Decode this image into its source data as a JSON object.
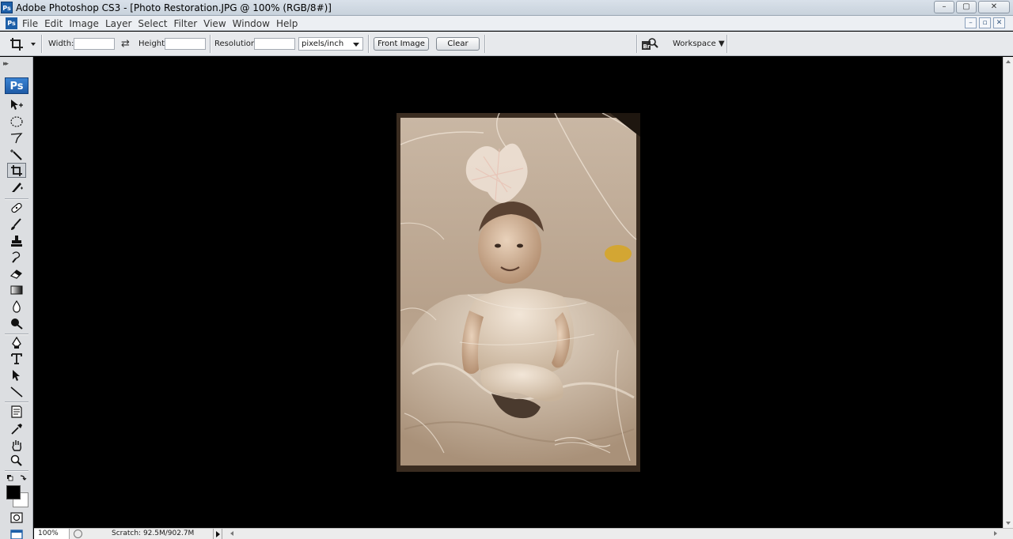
{
  "window": {
    "title": "Adobe Photoshop CS3 - [Photo Restoration.JPG @ 100% (RGB/8#)]",
    "app_icon_text": "Ps",
    "minimize": "–",
    "maximize": "▢",
    "close": "✕"
  },
  "menubar": {
    "items": [
      "File",
      "Edit",
      "Image",
      "Layer",
      "Select",
      "Filter",
      "View",
      "Window",
      "Help"
    ],
    "doc_minimize": "–",
    "doc_restore": "▫",
    "doc_close": "✕"
  },
  "options": {
    "width_label": "Width:",
    "width_value": "",
    "height_label": "Height:",
    "height_value": "",
    "resolution_label": "Resolution:",
    "resolution_value": "",
    "units_value": "pixels/inch",
    "front_image_label": "Front Image",
    "clear_label": "Clear",
    "workspace_label": "Workspace ▼",
    "bridge_icon_text": "Br",
    "swap_glyph": "⇄"
  },
  "toolbox": {
    "logo_text": "Ps",
    "grip_text": "▸▸",
    "active_tool": "crop-tool",
    "foreground_color": "#000000",
    "background_color": "#ffffff"
  },
  "document": {
    "name": "Photo Restoration.JPG",
    "zoom": "100%",
    "color_mode": "RGB/8#"
  },
  "statusbar": {
    "zoom": "100%",
    "scratch": "Scratch: 92.5M/902.7M"
  }
}
